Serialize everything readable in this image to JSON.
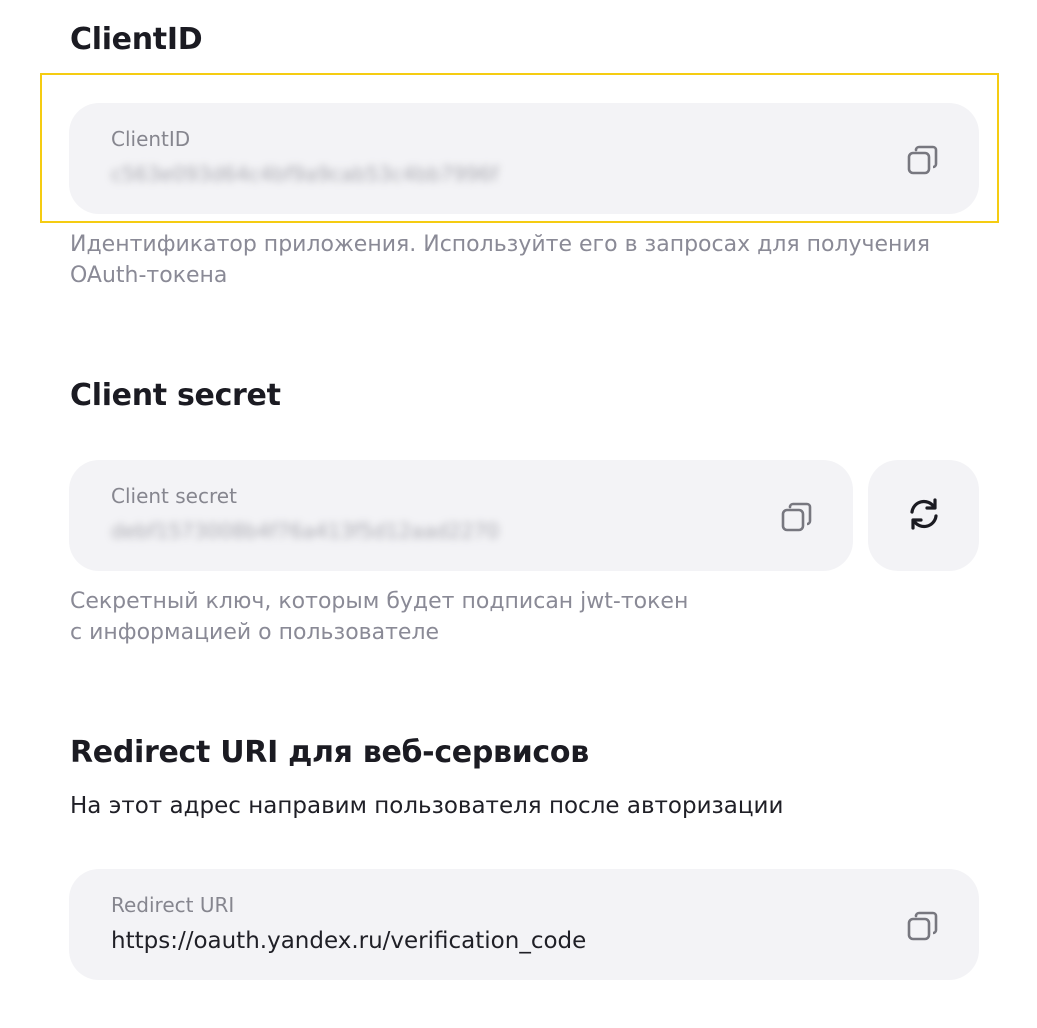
{
  "client_id_section": {
    "title": "ClientID",
    "field_label": "ClientID",
    "field_value": "c563e093d64c4bf9a9cab53c4bb7996f",
    "description_line1": "Идентификатор приложения. Используйте его в запросах для получения",
    "description_line2": "OAuth-токена",
    "copy_icon": "copy-icon"
  },
  "client_secret_section": {
    "title": "Client secret",
    "field_label": "Client secret",
    "field_value": "debf1573008b4f76a413f5d12aad2270",
    "description_line1": "Секретный ключ, которым будет подписан jwt-токен",
    "description_line2": "с информацией о пользователе",
    "copy_icon": "copy-icon",
    "refresh_icon": "refresh-icon"
  },
  "redirect_section": {
    "title": "Redirect URI для веб-сервисов",
    "subtitle": "На этот адрес направим пользователя после авторизации",
    "field_label": "Redirect URI",
    "field_value": "https://oauth.yandex.ru/verification_code",
    "copy_icon": "copy-icon"
  },
  "colors": {
    "highlight": "#f5cc12",
    "field_bg": "#f3f3f6",
    "muted_text": "#8a8a96"
  }
}
